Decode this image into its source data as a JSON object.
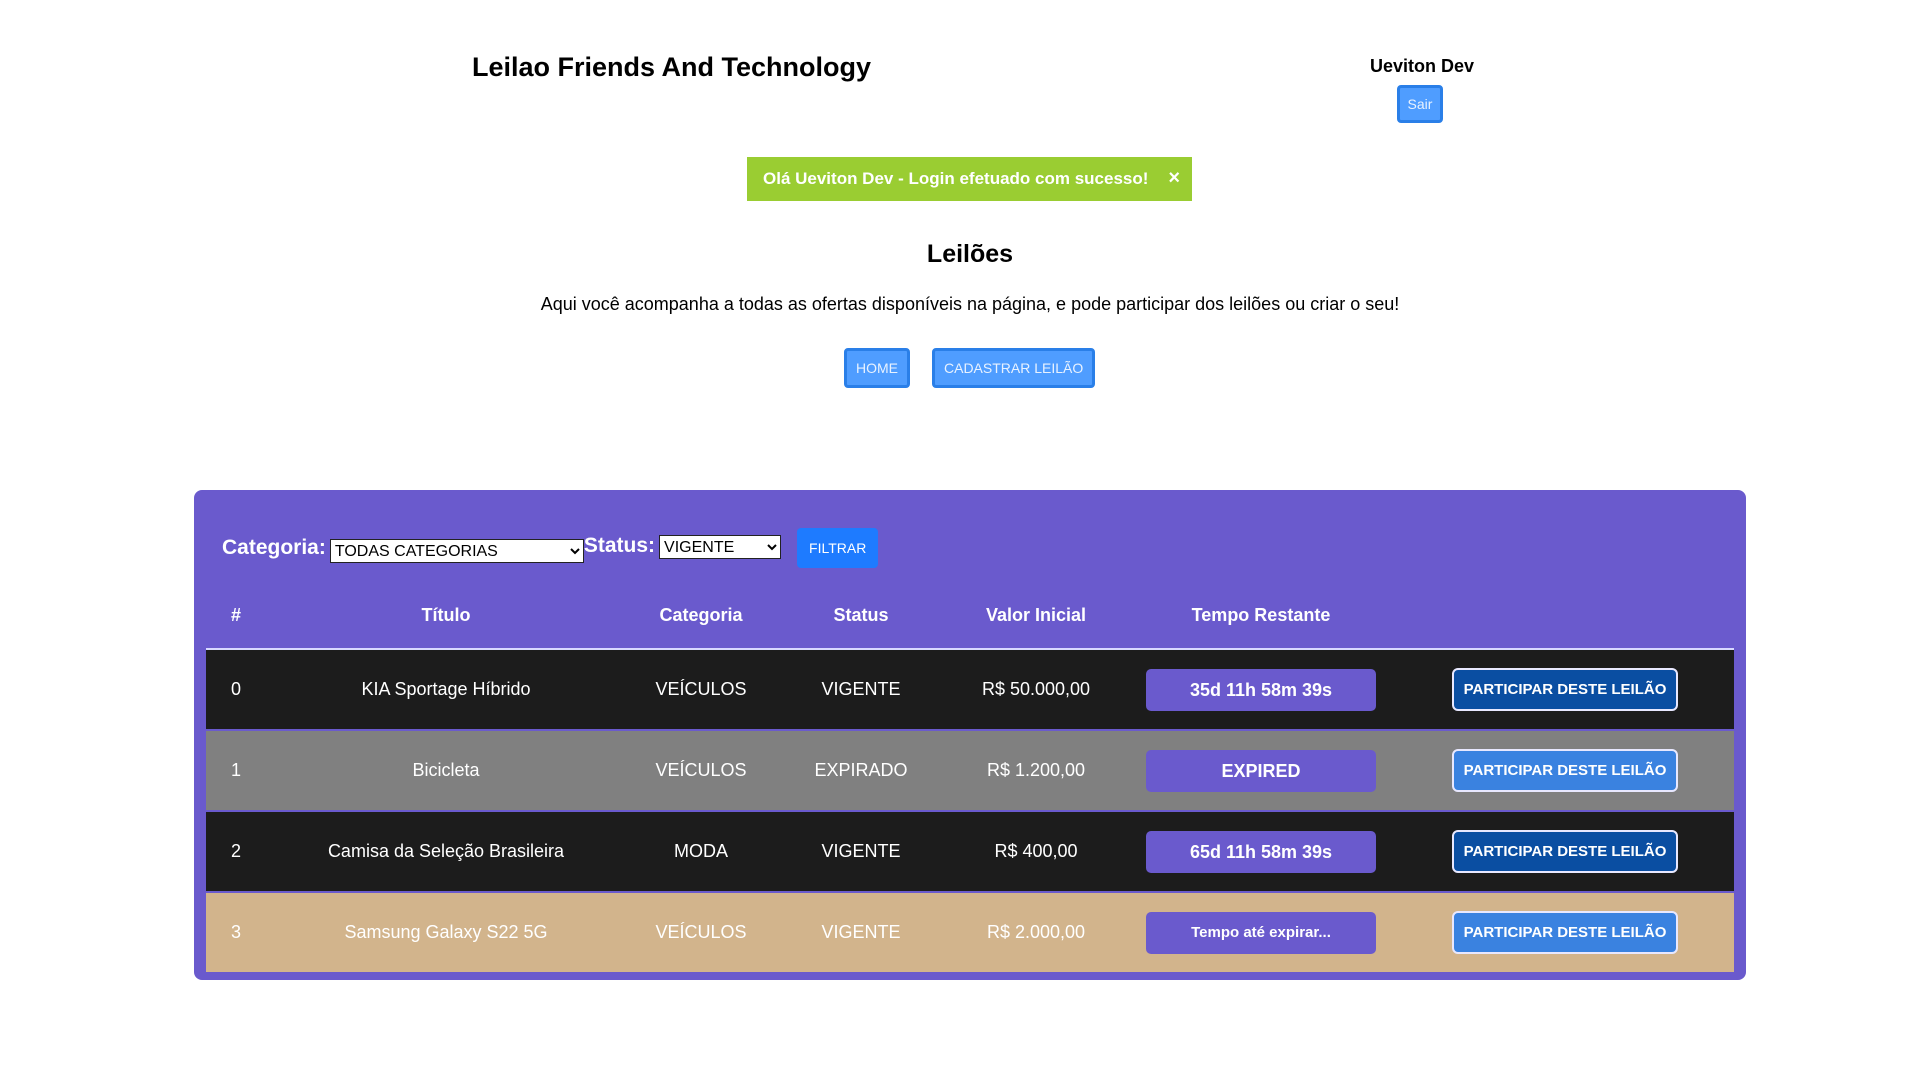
{
  "header": {
    "title": "Leilao Friends And Technology",
    "user_name": "Ueviton Dev",
    "logout_label": "Sair"
  },
  "alert": {
    "message": "Olá Ueviton Dev - Login efetuado com sucesso!",
    "close_symbol": "×"
  },
  "main": {
    "title": "Leilões",
    "description": "Aqui você acompanha a todas as ofertas disponíveis na página, e pode participar dos leilões ou criar o seu!",
    "home_label": "HOME",
    "create_label": "CADASTRAR LEILÃO"
  },
  "filters": {
    "category_label": "Categoria:",
    "category_value": "TODAS CATEGORIAS",
    "status_label": "Status:",
    "status_value": "VIGENTE",
    "filter_label": "FILTRAR"
  },
  "table": {
    "columns": [
      "#",
      "Título",
      "Categoria",
      "Status",
      "Valor Inicial",
      "Tempo Restante",
      ""
    ],
    "rows": [
      {
        "id": "0",
        "title": "KIA Sportage Híbrido",
        "category": "VEÍCULOS",
        "status": "VIGENTE",
        "value": "R$ 50.000,00",
        "time": "35d 11h 58m 39s",
        "action": "PARTICIPAR DESTE LEILÃO"
      },
      {
        "id": "1",
        "title": "Bicicleta",
        "category": "VEÍCULOS",
        "status": "EXPIRADO",
        "value": "R$ 1.200,00",
        "time": "EXPIRED",
        "action": "PARTICIPAR DESTE LEILÃO"
      },
      {
        "id": "2",
        "title": "Camisa da Seleção Brasileira",
        "category": "MODA",
        "status": "VIGENTE",
        "value": "R$ 400,00",
        "time": "65d 11h 58m 39s",
        "action": "PARTICIPAR DESTE LEILÃO"
      },
      {
        "id": "3",
        "title": "Samsung Galaxy S22 5G",
        "category": "VEÍCULOS",
        "status": "VIGENTE",
        "value": "R$ 2.000,00",
        "time": "Tempo até expirar...",
        "action": "PARTICIPAR DESTE LEILÃO"
      }
    ]
  },
  "colors": {
    "panel": "#6a5acd",
    "alert": "#9acd32",
    "button": "#4f9dff",
    "row_dark": "#1c1c1c",
    "row_gray": "#808080",
    "row_tan": "#d2b48c"
  }
}
